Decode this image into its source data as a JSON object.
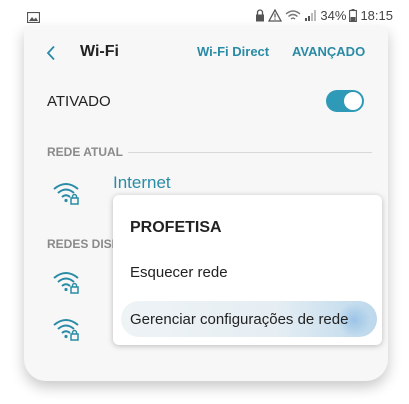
{
  "status_bar": {
    "battery": "34%",
    "time": "18:15",
    "icons": [
      "gallery-icon",
      "lock-icon",
      "warning-icon",
      "wifi-icon",
      "signal-icon",
      "battery-icon"
    ]
  },
  "header": {
    "title": "Wi-Fi",
    "wifi_direct": "Wi-Fi Direct",
    "advanced": "AVANÇADO"
  },
  "toggle": {
    "label": "ATIVADO",
    "on": true
  },
  "sections": {
    "current": "REDE ATUAL",
    "available": "REDES DISP"
  },
  "current_network": {
    "name": "Internet"
  },
  "context_menu": {
    "title": "PROFETISA",
    "items": [
      {
        "label": "Esquecer rede"
      },
      {
        "label": "Gerenciar configurações de rede"
      }
    ]
  },
  "colors": {
    "accent": "#2a8ba6",
    "switch": "#2f99b8",
    "background": "#f7f7f7"
  }
}
